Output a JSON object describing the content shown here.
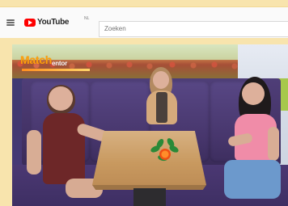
{
  "header": {
    "menu_icon": "menu-icon",
    "logo_text": "YouTube",
    "logo_country": "NL",
    "search_placeholder": "Zoeken"
  },
  "video": {
    "watermark_primary": "Match",
    "watermark_secondary": "entor"
  },
  "colors": {
    "page_background": "#f8e4ad",
    "youtube_red": "#ff0000",
    "watermark_orange": "#ff9f0a"
  }
}
